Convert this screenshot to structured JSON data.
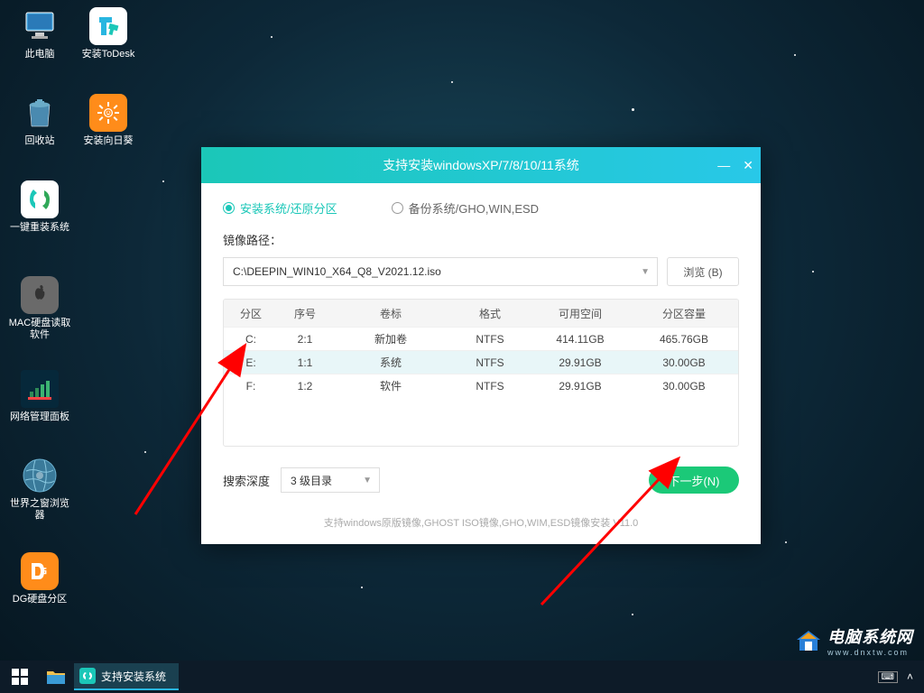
{
  "desktop": {
    "icons": [
      {
        "label": "此电脑",
        "key": "this-pc"
      },
      {
        "label": "安装ToDesk",
        "key": "todesk"
      },
      {
        "label": "回收站",
        "key": "recycle-bin"
      },
      {
        "label": "安装向日葵",
        "key": "sunflower"
      },
      {
        "label": "一键重装系统",
        "key": "one-click-reinstall"
      },
      {
        "label": "MAC硬盘读取软件",
        "key": "mac-disk-reader"
      },
      {
        "label": "网络管理面板",
        "key": "network-panel"
      },
      {
        "label": "世界之窗浏览器",
        "key": "theworld-browser"
      },
      {
        "label": "DG硬盘分区",
        "key": "dg-partition"
      }
    ]
  },
  "dialog": {
    "title": "支持安装windowsXP/7/8/10/11系统",
    "radio_install": "安装系统/还原分区",
    "radio_backup": "备份系统/GHO,WIN,ESD",
    "path_label": "镜像路径：",
    "path_value": "C:\\DEEPIN_WIN10_X64_Q8_V2021.12.iso",
    "browse": "浏览 (B)",
    "columns": [
      "分区",
      "序号",
      "卷标",
      "格式",
      "可用空间",
      "分区容量"
    ],
    "rows": [
      {
        "drive": "C:",
        "idx": "2:1",
        "label": "新加卷",
        "fmt": "NTFS",
        "free": "414.11GB",
        "cap": "465.76GB"
      },
      {
        "drive": "E:",
        "idx": "1:1",
        "label": "系统",
        "fmt": "NTFS",
        "free": "29.91GB",
        "cap": "30.00GB"
      },
      {
        "drive": "F:",
        "idx": "1:2",
        "label": "软件",
        "fmt": "NTFS",
        "free": "29.91GB",
        "cap": "30.00GB"
      }
    ],
    "depth_label": "搜索深度",
    "depth_value": "3 级目录",
    "next": "下一步(N)",
    "footer": "支持windows原版镜像,GHOST ISO镜像,GHO,WIM,ESD镜像安装 V11.0"
  },
  "taskbar": {
    "task_label": "支持安装系统"
  },
  "watermark": {
    "main": "电脑系统网",
    "sub": "www.dnxtw.com"
  }
}
